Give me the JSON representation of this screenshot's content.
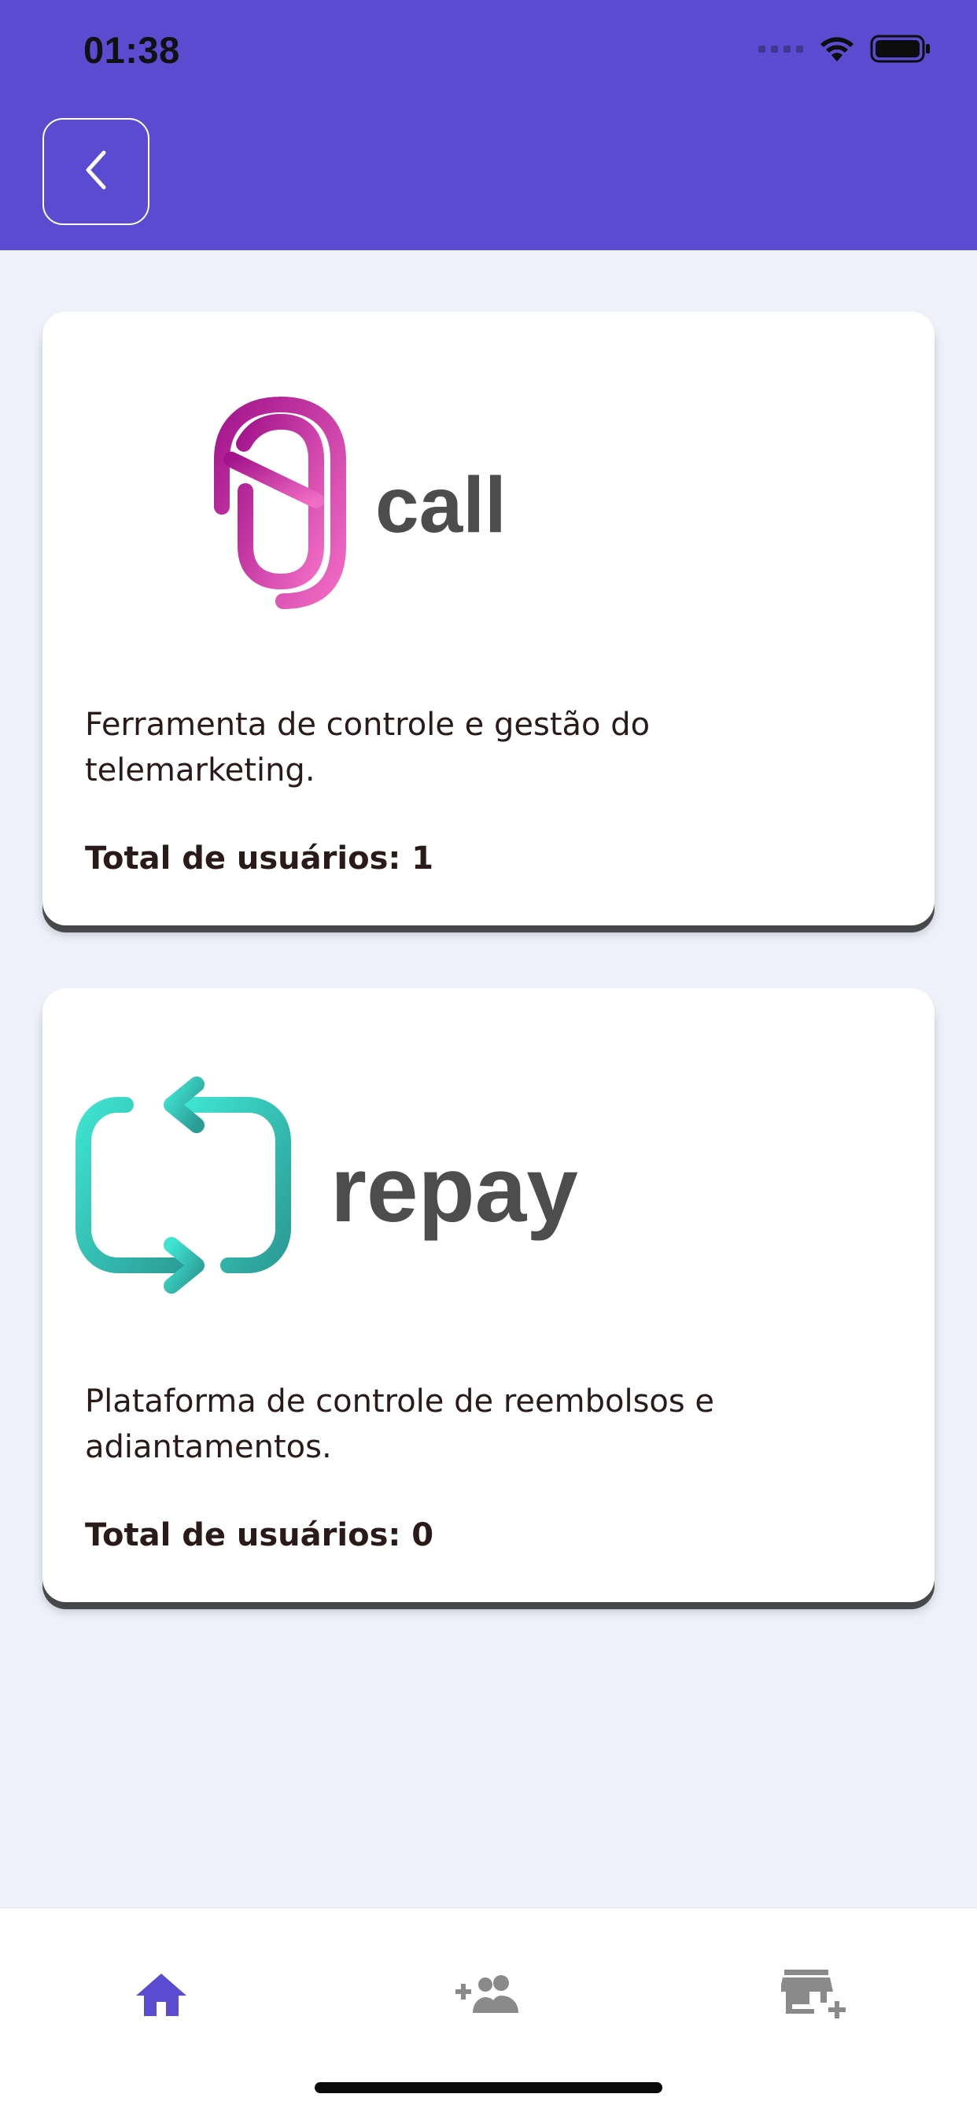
{
  "status_bar": {
    "time": "01:38",
    "signal_icon": "signal-dots-icon",
    "wifi_icon": "wifi-icon",
    "battery_icon": "battery-icon"
  },
  "header": {
    "background": "#5a4bd1",
    "back_icon": "chevron-left-icon"
  },
  "products": [
    {
      "logo_text": "call",
      "logo_icon": "call-logo-icon",
      "description": "Ferramenta de controle e gestão do telemarketing.",
      "total_label": "Total de usuários: 1"
    },
    {
      "logo_text": "repay",
      "logo_icon": "repay-logo-icon",
      "description": "Plataforma de controle de reembolsos e adiantamentos.",
      "total_label": "Total de usuários: 0"
    }
  ],
  "tabbar": {
    "items": [
      {
        "icon": "home-icon",
        "active": true,
        "color": "#5a4bd1"
      },
      {
        "icon": "add-user-group-icon",
        "active": false,
        "color": "#8a8a8a"
      },
      {
        "icon": "add-store-icon",
        "active": false,
        "color": "#8a8a8a"
      }
    ]
  }
}
